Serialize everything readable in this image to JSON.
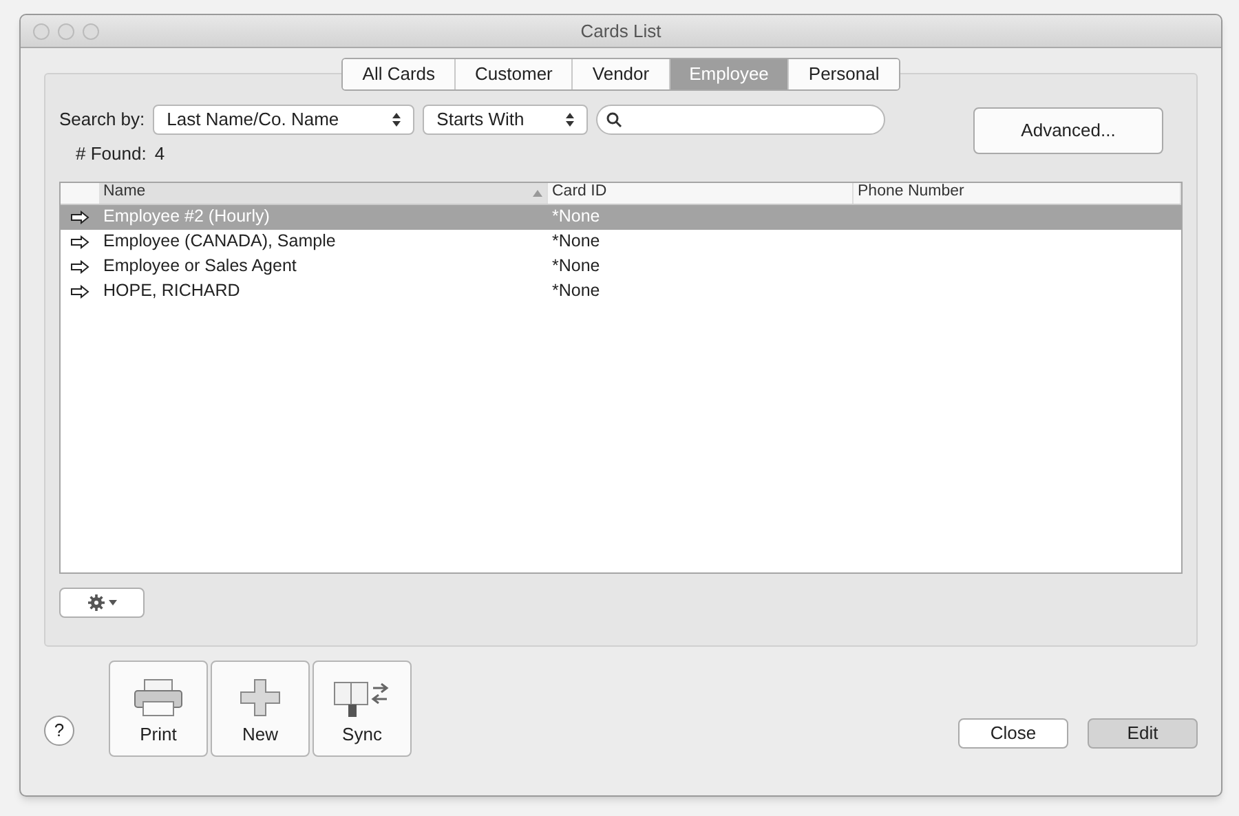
{
  "window": {
    "title": "Cards List"
  },
  "tabs": [
    {
      "label": "All Cards",
      "selected": false
    },
    {
      "label": "Customer",
      "selected": false
    },
    {
      "label": "Vendor",
      "selected": false
    },
    {
      "label": "Employee",
      "selected": true
    },
    {
      "label": "Personal",
      "selected": false
    }
  ],
  "search": {
    "label": "Search by:",
    "field_select": "Last Name/Co. Name",
    "match_select": "Starts With",
    "found_label": "# Found:",
    "found_count": "4"
  },
  "advanced_button": "Advanced...",
  "table": {
    "columns": [
      {
        "label": "Name",
        "sorted": true
      },
      {
        "label": "Card ID",
        "sorted": false
      },
      {
        "label": "Phone Number",
        "sorted": false
      }
    ],
    "rows": [
      {
        "name": "Employee #2 (Hourly)",
        "card_id": "*None",
        "selected": true
      },
      {
        "name": "Employee (CANADA), Sample",
        "card_id": "*None",
        "selected": false
      },
      {
        "name": "Employee or Sales Agent",
        "card_id": "*None",
        "selected": false
      },
      {
        "name": "HOPE, RICHARD",
        "card_id": "*None",
        "selected": false
      }
    ]
  },
  "toolbar": [
    {
      "kind": "print",
      "label": "Print"
    },
    {
      "kind": "new",
      "label": "New"
    },
    {
      "kind": "sync",
      "label": "Sync"
    }
  ],
  "help_button": "?",
  "buttons": [
    {
      "label": "Close",
      "default": false
    },
    {
      "label": "Edit",
      "default": true
    }
  ]
}
